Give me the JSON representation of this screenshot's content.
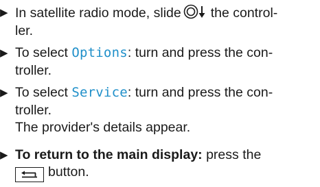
{
  "steps": [
    {
      "arrow": "▶",
      "line1_pre": "In satellite radio mode, slide",
      "line1_post": "the control-",
      "line2": "ler.",
      "slide_icon": "controller-slide-down-icon"
    },
    {
      "arrow": "▶",
      "line1_pre": "To select ",
      "term": "Options",
      "line1_post": ": turn and press the con-",
      "line2": "troller."
    },
    {
      "arrow": "▶",
      "line1_pre": "To select ",
      "term": "Service",
      "line1_post": ": turn and press the con-",
      "line2": "troller.",
      "result": "The provider's details appear."
    },
    {
      "arrow": "▶",
      "bold_lead": "To return to the main display:",
      "line1_post": " press the",
      "line2": "button.",
      "key_icon": "back-button-icon"
    }
  ],
  "colors": {
    "text": "#1a1a1a",
    "display_term": "#1f8fc9"
  }
}
